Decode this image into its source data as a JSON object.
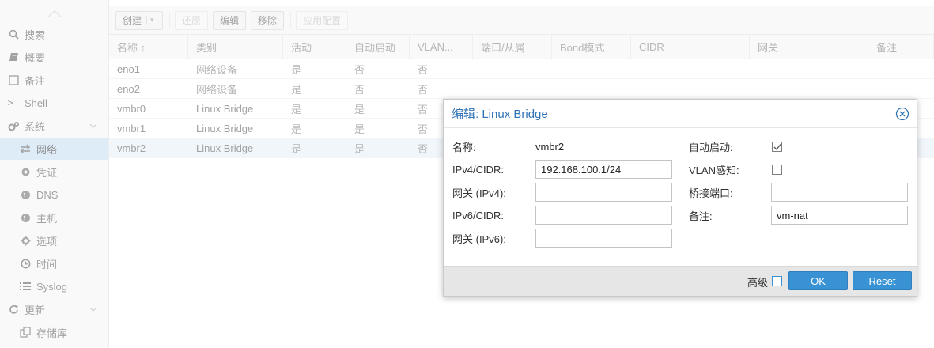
{
  "sidebar": {
    "items": [
      {
        "label": "搜索",
        "icon": "search-icon"
      },
      {
        "label": "概要",
        "icon": "book-icon"
      },
      {
        "label": "备注",
        "icon": "note-icon"
      },
      {
        "label": "Shell",
        "icon": "terminal-icon"
      },
      {
        "label": "系统",
        "icon": "gears-icon"
      },
      {
        "label": "网络",
        "icon": "exchange-icon"
      },
      {
        "label": "凭证",
        "icon": "certificate-icon"
      },
      {
        "label": "DNS",
        "icon": "globe-icon"
      },
      {
        "label": "主机",
        "icon": "globe-icon"
      },
      {
        "label": "选项",
        "icon": "gear-icon"
      },
      {
        "label": "时间",
        "icon": "clock-icon"
      },
      {
        "label": "Syslog",
        "icon": "list-icon"
      },
      {
        "label": "更新",
        "icon": "refresh-icon"
      },
      {
        "label": "存储库",
        "icon": "files-icon"
      }
    ]
  },
  "toolbar": {
    "create": "创建",
    "revert": "还原",
    "edit": "编辑",
    "remove": "移除",
    "apply": "应用配置"
  },
  "grid": {
    "columns": [
      "名称 ↑",
      "类别",
      "活动",
      "自动启动",
      "VLAN...",
      "端口/从属",
      "Bond模式",
      "CIDR",
      "网关",
      "备注"
    ],
    "rows": [
      [
        "eno1",
        "网络设备",
        "是",
        "否",
        "否"
      ],
      [
        "eno2",
        "网络设备",
        "是",
        "否",
        "否"
      ],
      [
        "vmbr0",
        "Linux Bridge",
        "是",
        "是",
        "否"
      ],
      [
        "vmbr1",
        "Linux Bridge",
        "是",
        "是",
        "否"
      ],
      [
        "vmbr2",
        "Linux Bridge",
        "是",
        "是",
        "否"
      ]
    ]
  },
  "dialog": {
    "title": "编辑: Linux Bridge",
    "name_label": "名称:",
    "name_value": "vmbr2",
    "ipv4_label": "IPv4/CIDR:",
    "ipv4_value": "192.168.100.1/24",
    "gw4_label": "网关 (IPv4):",
    "gw4_value": "",
    "ipv6_label": "IPv6/CIDR:",
    "ipv6_value": "",
    "gw6_label": "网关 (IPv6):",
    "gw6_value": "",
    "autostart_label": "自动启动:",
    "autostart_checked": true,
    "vlan_label": "VLAN感知:",
    "vlan_checked": false,
    "ports_label": "桥接端口:",
    "ports_value": "",
    "comment_label": "备注:",
    "comment_value": "vm-nat",
    "advanced_label": "高级",
    "ok_label": "OK",
    "reset_label": "Reset"
  },
  "colors": {
    "accent": "#3892d4",
    "title": "#2f73b5",
    "selected": "#c3dcf2"
  }
}
